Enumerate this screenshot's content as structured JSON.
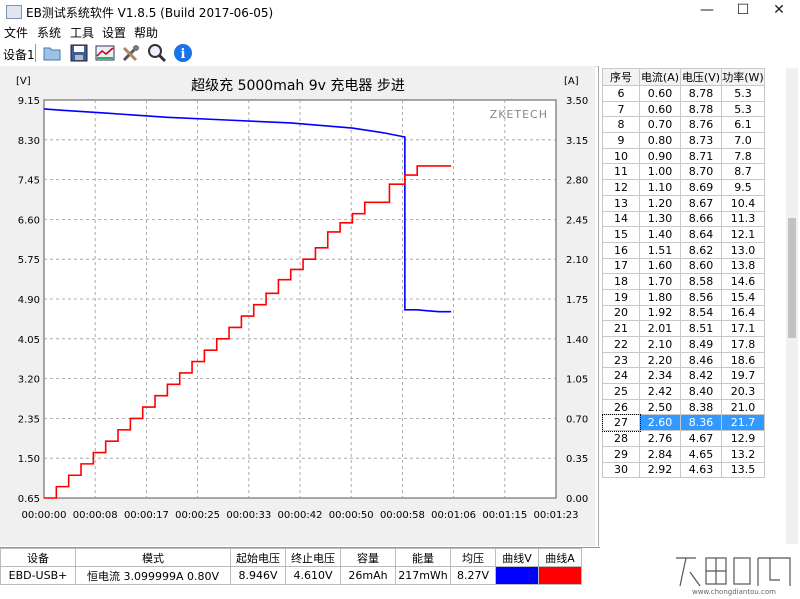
{
  "window": {
    "title": "EB测试系统软件 V1.8.5 (Build 2017-06-05)",
    "min": "—",
    "max": "☐",
    "close": "✕"
  },
  "menu": [
    "文件",
    "系统",
    "工具",
    "设置",
    "帮助"
  ],
  "toolbar": {
    "device_label": "设备1",
    "buttons": [
      "open-icon",
      "save-icon",
      "chart-icon",
      "tools-icon",
      "search-icon",
      "info-icon"
    ]
  },
  "chart_data": {
    "type": "line",
    "title": "超级充  5000mah  9v 充电器 步进",
    "watermark": "ZKETECH",
    "y_left_unit": "[V]",
    "y_right_unit": "[A]",
    "y_left_ticks": [
      "9.15",
      "8.30",
      "7.45",
      "6.60",
      "5.75",
      "4.90",
      "4.05",
      "3.20",
      "2.35",
      "1.50",
      "0.65"
    ],
    "y_right_ticks": [
      "3.50",
      "3.15",
      "2.80",
      "2.45",
      "2.10",
      "1.75",
      "1.40",
      "1.05",
      "0.70",
      "0.35",
      "0.00"
    ],
    "x_ticks": [
      "00:00:00",
      "00:00:08",
      "00:00:17",
      "00:00:25",
      "00:00:33",
      "00:00:42",
      "00:00:50",
      "00:00:58",
      "00:01:06",
      "00:01:15",
      "00:01:23"
    ],
    "ylim_left": [
      0.65,
      9.15
    ],
    "ylim_right": [
      0,
      3.5
    ],
    "xlim_seconds": [
      0,
      83
    ],
    "grid": true,
    "series": [
      {
        "name": "V",
        "color": "#0000ff",
        "axis": "left",
        "points": [
          [
            0,
            8.96
          ],
          [
            3,
            8.93
          ],
          [
            10,
            8.87
          ],
          [
            20,
            8.78
          ],
          [
            30,
            8.72
          ],
          [
            40,
            8.66
          ],
          [
            50,
            8.55
          ],
          [
            55,
            8.45
          ],
          [
            58.5,
            8.36
          ],
          [
            58.5,
            4.67
          ],
          [
            60.5,
            4.67
          ],
          [
            62,
            4.65
          ],
          [
            64,
            4.63
          ],
          [
            66,
            4.63
          ]
        ]
      },
      {
        "name": "A",
        "color": "#ff0000",
        "axis": "right",
        "step_x": [
          0,
          2,
          4,
          6,
          8,
          10,
          12,
          14,
          16,
          18,
          20,
          22,
          24,
          26,
          28,
          30,
          32,
          34,
          36,
          38,
          40,
          42,
          44,
          46,
          48,
          50,
          52,
          54,
          56,
          58.5,
          60.5,
          62.5,
          64.5,
          66
        ],
        "step_y": [
          0.0,
          0.1,
          0.2,
          0.3,
          0.4,
          0.5,
          0.6,
          0.7,
          0.8,
          0.9,
          1.0,
          1.1,
          1.2,
          1.3,
          1.4,
          1.5,
          1.6,
          1.7,
          1.8,
          1.92,
          2.01,
          2.1,
          2.2,
          2.34,
          2.42,
          2.5,
          2.6,
          2.6,
          2.76,
          2.84,
          2.92,
          2.92,
          2.92
        ]
      }
    ]
  },
  "table": {
    "headers": [
      "序号",
      "电流(A)",
      "电压(V)",
      "功率(W)"
    ],
    "rows": [
      [
        "6",
        "0.60",
        "8.78",
        "5.3"
      ],
      [
        "7",
        "0.60",
        "8.78",
        "5.3"
      ],
      [
        "8",
        "0.70",
        "8.76",
        "6.1"
      ],
      [
        "9",
        "0.80",
        "8.73",
        "7.0"
      ],
      [
        "10",
        "0.90",
        "8.71",
        "7.8"
      ],
      [
        "11",
        "1.00",
        "8.70",
        "8.7"
      ],
      [
        "12",
        "1.10",
        "8.69",
        "9.5"
      ],
      [
        "13",
        "1.20",
        "8.67",
        "10.4"
      ],
      [
        "14",
        "1.30",
        "8.66",
        "11.3"
      ],
      [
        "15",
        "1.40",
        "8.64",
        "12.1"
      ],
      [
        "16",
        "1.51",
        "8.62",
        "13.0"
      ],
      [
        "17",
        "1.60",
        "8.60",
        "13.8"
      ],
      [
        "18",
        "1.70",
        "8.58",
        "14.6"
      ],
      [
        "19",
        "1.80",
        "8.56",
        "15.4"
      ],
      [
        "20",
        "1.92",
        "8.54",
        "16.4"
      ],
      [
        "21",
        "2.01",
        "8.51",
        "17.1"
      ],
      [
        "22",
        "2.10",
        "8.49",
        "17.8"
      ],
      [
        "23",
        "2.20",
        "8.46",
        "18.6"
      ],
      [
        "24",
        "2.34",
        "8.42",
        "19.7"
      ],
      [
        "25",
        "2.42",
        "8.40",
        "20.3"
      ],
      [
        "26",
        "2.50",
        "8.38",
        "21.0"
      ],
      [
        "27",
        "2.60",
        "8.36",
        "21.7"
      ],
      [
        "28",
        "2.76",
        "4.67",
        "12.9"
      ],
      [
        "29",
        "2.84",
        "4.65",
        "13.2"
      ],
      [
        "30",
        "2.92",
        "4.63",
        "13.5"
      ]
    ],
    "selected_index": "27"
  },
  "status": {
    "headers": [
      "设备",
      "模式",
      "起始电压",
      "终止电压",
      "容量",
      "能量",
      "均压",
      "曲线V",
      "曲线A"
    ],
    "values": [
      "EBD-USB+",
      "恒电流  3.099999A  0.80V",
      "8.946V",
      "4.610V",
      "26mAh",
      "217mWh",
      "8.27V",
      "",
      ""
    ],
    "curve_colors": [
      "#0000ff",
      "#ff0000"
    ]
  },
  "watermark": {
    "text": "充电头网",
    "url": "www.chongdiantou.com"
  }
}
